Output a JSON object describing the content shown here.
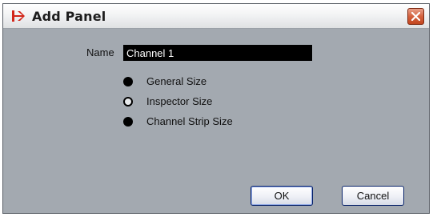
{
  "window": {
    "title": "Add Panel",
    "app_icon": "arrow-logo-icon",
    "close_icon": "close-icon"
  },
  "form": {
    "name_label": "Name",
    "name_value": "Channel 1"
  },
  "size_options": [
    {
      "label": "General Size",
      "selected": true
    },
    {
      "label": "Inspector Size",
      "selected": false
    },
    {
      "label": "Channel Strip Size",
      "selected": true
    }
  ],
  "buttons": {
    "ok_label": "OK",
    "cancel_label": "Cancel"
  },
  "colors": {
    "dialog_background": "#a3a9b0",
    "logo_red": "#d2271b",
    "close_button": "#d4613e"
  }
}
